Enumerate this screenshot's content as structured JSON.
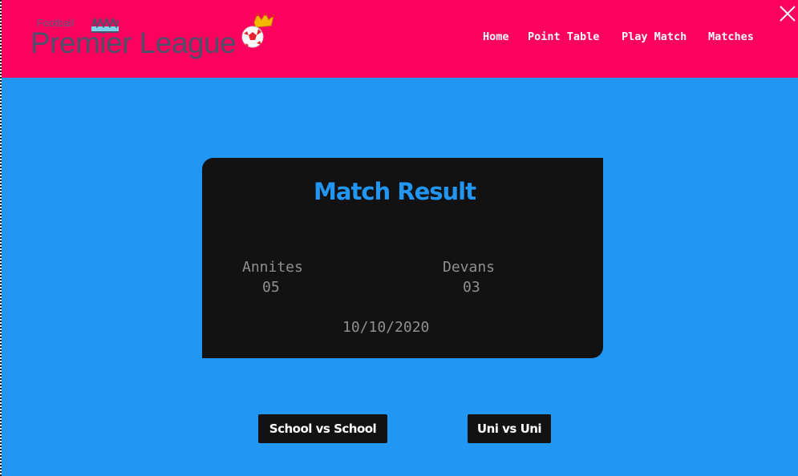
{
  "header": {
    "logo_small": "Football",
    "logo_main": "Premier League",
    "nav": [
      "Home",
      "Point Table",
      "Play Match",
      "Matches"
    ],
    "icons": {
      "close": "close-icon",
      "crown": "crown-icon",
      "ball": "soccer-ball-icon"
    }
  },
  "card": {
    "title": "Match Result",
    "team1": {
      "name": "Annites",
      "score": "05"
    },
    "team2": {
      "name": "Devans",
      "score": "03"
    },
    "date": "10/10/2020"
  },
  "buttons": {
    "school": "School vs School",
    "uni": "Uni vs Uni"
  },
  "colors": {
    "header": "#fe005e",
    "background": "#2196f3",
    "card": "#121212",
    "title": "#2196f3"
  }
}
